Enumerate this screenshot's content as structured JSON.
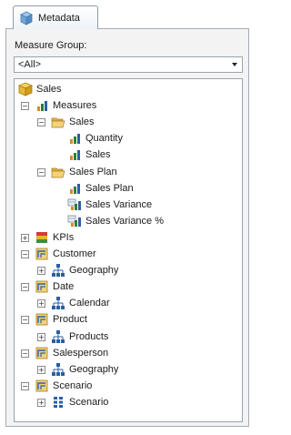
{
  "tab": {
    "label": "Metadata"
  },
  "measure_group": {
    "label": "Measure Group:",
    "selected": "<All>"
  },
  "tree": [
    {
      "label": "Sales"
    },
    {
      "label": "Measures"
    },
    {
      "label": "Sales"
    },
    {
      "label": "Quantity"
    },
    {
      "label": "Sales"
    },
    {
      "label": "Sales Plan"
    },
    {
      "label": "Sales Plan"
    },
    {
      "label": "Sales Variance"
    },
    {
      "label": "Sales Variance %"
    },
    {
      "label": "KPIs"
    },
    {
      "label": "Customer"
    },
    {
      "label": "Geography"
    },
    {
      "label": "Date"
    },
    {
      "label": "Calendar"
    },
    {
      "label": "Product"
    },
    {
      "label": "Products"
    },
    {
      "label": "Salesperson"
    },
    {
      "label": "Geography"
    },
    {
      "label": "Scenario"
    },
    {
      "label": "Scenario"
    }
  ],
  "icons": [
    "cube-icon",
    "measure-bars-icon",
    "folder-open-icon",
    "measure-bars-icon",
    "measure-bars-icon",
    "folder-open-icon",
    "measure-bars-icon",
    "calculated-measure-icon",
    "calculated-measure-icon",
    "kpi-icon",
    "dimension-icon",
    "hierarchy-icon",
    "dimension-icon",
    "hierarchy-icon",
    "dimension-icon",
    "hierarchy-icon",
    "dimension-icon",
    "hierarchy-icon",
    "dimension-icon",
    "attribute-icon"
  ]
}
